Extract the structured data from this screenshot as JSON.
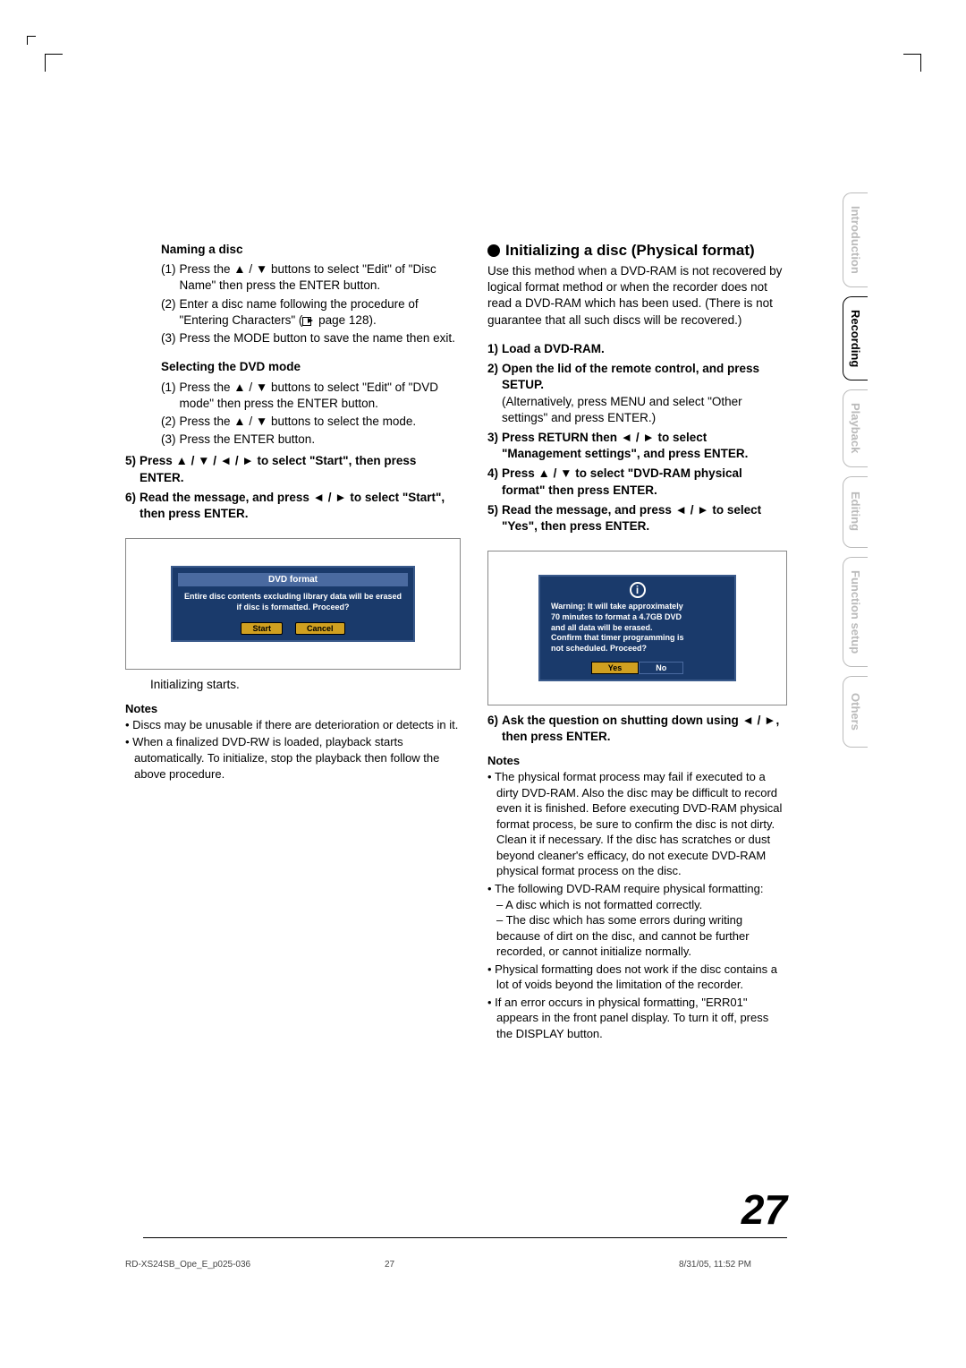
{
  "sidebar": {
    "tabs": [
      {
        "label": "Introduction",
        "active": false
      },
      {
        "label": "Recording",
        "active": true
      },
      {
        "label": "Playback",
        "active": false
      },
      {
        "label": "Editing",
        "active": false
      },
      {
        "label": "Function setup",
        "active": false
      },
      {
        "label": "Others",
        "active": false
      }
    ]
  },
  "left": {
    "naming_heading": "Naming a disc",
    "naming_steps": [
      "Press the ▲ / ▼ buttons to select \"Edit\" of \"Disc Name\" then press the ENTER button.",
      "Enter a disc name following the procedure of \"Entering Characters\" ( page 128).",
      "Press the MODE button to save the name then exit."
    ],
    "dvdmode_heading": "Selecting the DVD mode",
    "dvdmode_steps": [
      "Press the ▲ / ▼ buttons to select \"Edit\" of \"DVD mode\" then press the ENTER button.",
      "Press the ▲ / ▼ buttons to select the mode.",
      "Press the ENTER button."
    ],
    "outer_steps": [
      "Press ▲ / ▼ / ◄ / ► to select \"Start\", then press ENTER.",
      "Read the message, and press ◄ / ► to select \"Start\", then press ENTER."
    ],
    "outer_step_numbers": [
      "5)",
      "6)"
    ],
    "dialog": {
      "title": "DVD format",
      "body": "Entire disc contents excluding library data will be erased if disc is formatted. Proceed?",
      "buttons": [
        "Start",
        "Cancel"
      ]
    },
    "after_dialog": "Initializing starts.",
    "notes_title": "Notes",
    "notes": [
      "Discs may be unusable if there are deterioration or detects in it.",
      "When a finalized DVD-RW is loaded, playback starts automatically. To initialize, stop the playback then follow the above procedure."
    ]
  },
  "right": {
    "section_title": "Initializing a disc (Physical format)",
    "intro": "Use this method when a DVD-RAM is not recovered by logical format method or when the recorder does not read a DVD-RAM which has been used. (There is not guarantee that all such discs will be recovered.)",
    "steps": [
      {
        "num": "1)",
        "bold": "Load a DVD-RAM.",
        "sub": ""
      },
      {
        "num": "2)",
        "bold": "Open the lid of the remote control, and press SETUP.",
        "sub": "(Alternatively, press MENU and select \"Other settings\" and press ENTER.)"
      },
      {
        "num": "3)",
        "bold": "Press RETURN then ◄ / ► to select \"Management settings\", and press ENTER.",
        "sub": ""
      },
      {
        "num": "4)",
        "bold": "Press ▲ / ▼ to select \"DVD-RAM physical format\" then press ENTER.",
        "sub": ""
      },
      {
        "num": "5)",
        "bold": "Read the message, and press ◄ / ► to select \"Yes\", then press ENTER.",
        "sub": ""
      }
    ],
    "dialog": {
      "warning_lines": [
        "Warning: It will take approximately",
        "70 minutes to format a 4.7GB DVD",
        "and all data will be erased.",
        "Confirm that timer programming is",
        "not scheduled. Proceed?"
      ],
      "yes": "Yes",
      "no": "No"
    },
    "step6": {
      "num": "6)",
      "bold": "Ask the question on shutting down using ◄ / ►, then press ENTER."
    },
    "notes_title": "Notes",
    "notes": [
      "The physical format process may fail if executed to a dirty DVD-RAM. Also the disc may be difficult to record even it is finished. Before executing DVD-RAM physical format process, be sure to confirm the disc is not dirty. Clean it if necessary. If the disc has scratches or dust beyond cleaner's efficacy, do not execute DVD-RAM physical format process on the disc.",
      "The following DVD-RAM require physical formatting:\n– A disc which is not formatted correctly.\n– The disc which has some errors during writing because of dirt on the disc, and cannot be further recorded, or cannot initialize normally.",
      "Physical formatting does not work if the disc contains a lot of voids beyond the limitation of the recorder.",
      "If an error occurs in physical formatting, \"ERR01\" appears in the front panel display. To turn it off, press the DISPLAY button."
    ]
  },
  "page_number": "27",
  "footer": {
    "left": "RD-XS24SB_Ope_E_p025-036",
    "center": "27",
    "right": "8/31/05, 11:52 PM"
  }
}
